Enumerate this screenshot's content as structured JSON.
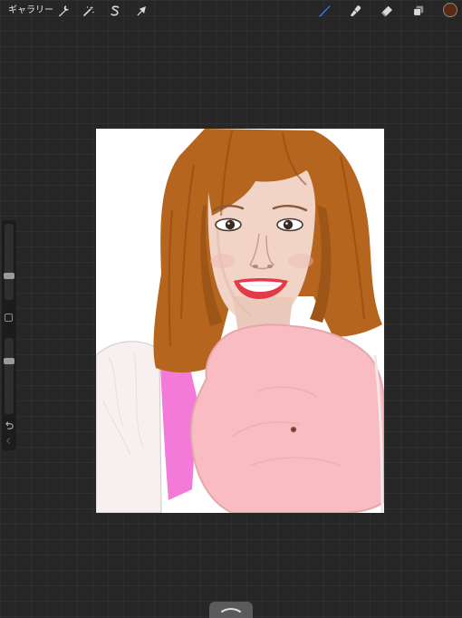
{
  "toolbar": {
    "gallery_label": "ギャラリー",
    "left_tools": [
      {
        "name": "actions-icon",
        "icon": "wrench"
      },
      {
        "name": "adjustments-icon",
        "icon": "magic-wand"
      },
      {
        "name": "selection-icon",
        "icon": "s-selection"
      },
      {
        "name": "transform-icon",
        "icon": "arrow"
      }
    ],
    "right_tools": [
      {
        "name": "brush-icon",
        "icon": "brush",
        "active": true
      },
      {
        "name": "smudge-icon",
        "icon": "finger"
      },
      {
        "name": "eraser-icon",
        "icon": "eraser"
      },
      {
        "name": "layers-icon",
        "icon": "layers"
      }
    ],
    "active_tool_color": "#3b7cf5",
    "current_color": "#5b2a12"
  },
  "sidebar": {
    "brush_size": 0.3,
    "brush_opacity": 0.72,
    "modify_icon": "square",
    "undo_icon": "undo-arrow",
    "redo_icon": "redo-arrow"
  },
  "canvas": {
    "background": "#ffffff",
    "palette": {
      "hair": "#b5651d",
      "skin": "#f1d4c6",
      "lips": "#e23a48",
      "blob": "#f9bcc2",
      "magenta": "#f37ad8"
    }
  },
  "bottom_handle_icon": "chevron-up"
}
